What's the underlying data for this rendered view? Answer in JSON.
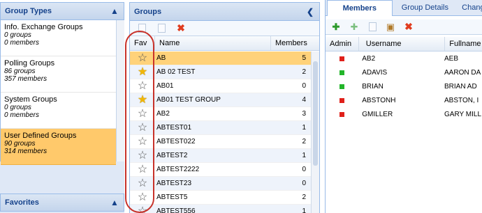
{
  "left_panel": {
    "title": "Group Types",
    "group_types": [
      {
        "title": "Info. Exchange Groups",
        "groups": "0 groups",
        "members": "0 members",
        "selected": false
      },
      {
        "title": "Polling Groups",
        "groups": "86 groups",
        "members": "357 members",
        "selected": false
      },
      {
        "title": "System Groups",
        "groups": "0 groups",
        "members": "0 members",
        "selected": false
      },
      {
        "title": "User Defined Groups",
        "groups": "90 groups",
        "members": "314 members",
        "selected": true
      }
    ],
    "favorites_title": "Favorites"
  },
  "middle_panel": {
    "title": "Groups",
    "columns": {
      "fav": "Fav",
      "name": "Name",
      "members": "Members"
    },
    "rows": [
      {
        "name": "AB",
        "members": "5",
        "fav": false,
        "selected": true
      },
      {
        "name": "AB 02 TEST",
        "members": "2",
        "fav": true,
        "selected": false
      },
      {
        "name": "AB01",
        "members": "0",
        "fav": false,
        "selected": false
      },
      {
        "name": "AB01 TEST GROUP",
        "members": "4",
        "fav": true,
        "selected": false
      },
      {
        "name": "AB2",
        "members": "3",
        "fav": false,
        "selected": false
      },
      {
        "name": "ABTEST01",
        "members": "1",
        "fav": false,
        "selected": false
      },
      {
        "name": "ABTEST022",
        "members": "2",
        "fav": false,
        "selected": false
      },
      {
        "name": "ABTEST2",
        "members": "1",
        "fav": false,
        "selected": false
      },
      {
        "name": "ABTEST2222",
        "members": "0",
        "fav": false,
        "selected": false
      },
      {
        "name": "ABTEST23",
        "members": "0",
        "fav": false,
        "selected": false
      },
      {
        "name": "ABTEST5",
        "members": "2",
        "fav": false,
        "selected": false
      },
      {
        "name": "ABTEST556",
        "members": "1",
        "fav": false,
        "selected": false
      }
    ]
  },
  "right_panel": {
    "tabs": [
      "Members",
      "Group Details",
      "Chang"
    ],
    "columns": {
      "admin": "Admin",
      "username": "Username",
      "fullname": "Fullname"
    },
    "rows": [
      {
        "admin": "red",
        "username": "AB2",
        "fullname": "AEB"
      },
      {
        "admin": "green",
        "username": "ADAVIS",
        "fullname": "AARON DA"
      },
      {
        "admin": "green",
        "username": "BRIAN",
        "fullname": "BRIAN AD"
      },
      {
        "admin": "red",
        "username": "ABSTONH",
        "fullname": "ABSTON, I"
      },
      {
        "admin": "red",
        "username": "GMILLER",
        "fullname": "GARY MILL"
      }
    ]
  },
  "colors": {
    "admin_red": "#e0201a",
    "admin_green": "#22b52a",
    "selection": "#ffd27a"
  }
}
